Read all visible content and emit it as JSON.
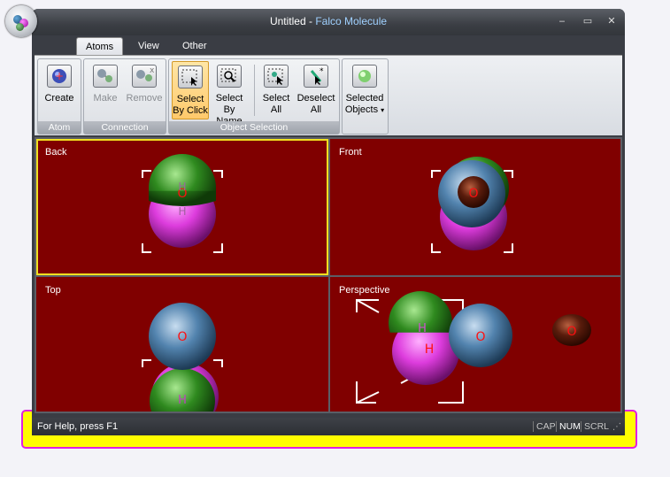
{
  "window": {
    "title_doc": "Untitled",
    "title_sep": " - ",
    "title_app": "Falco Molecule",
    "controls": {
      "minimize": "‒",
      "maximize": "▭",
      "close": "✕"
    }
  },
  "tabs": [
    {
      "label": "Atoms",
      "active": true
    },
    {
      "label": "View",
      "active": false
    },
    {
      "label": "Other",
      "active": false
    }
  ],
  "ribbon": {
    "groups": {
      "atom": {
        "label": "Atom",
        "create": "Create"
      },
      "connection": {
        "label": "Connection",
        "make": "Make",
        "remove": "Remove"
      },
      "selection": {
        "label": "Object Selection",
        "by_click_1": "Select",
        "by_click_2": "By Click",
        "by_name_1": "Select",
        "by_name_2": "By Name",
        "all_1": "Select",
        "all_2": "All",
        "deselect_1": "Deselect",
        "deselect_2": "All"
      },
      "selected": {
        "line1": "Selected",
        "line2": "Objects",
        "arrow": "▾"
      }
    }
  },
  "viewports": {
    "back": "Back",
    "front": "Front",
    "top": "Top",
    "perspective": "Perspective"
  },
  "atoms": {
    "oxygen": "O",
    "hydrogen": "H"
  },
  "colors": {
    "viewport_bg": "#800000",
    "oxygen": "#4f7ea8",
    "hydrogen_green": "#2e8a1e",
    "hydrogen_magenta": "#e040e0",
    "label_red": "#ff1010",
    "selection_outline": "#f0e020"
  },
  "status": {
    "help": "For Help, press F1",
    "cap": "CAP",
    "num": "NUM",
    "scrl": "SCRL"
  }
}
